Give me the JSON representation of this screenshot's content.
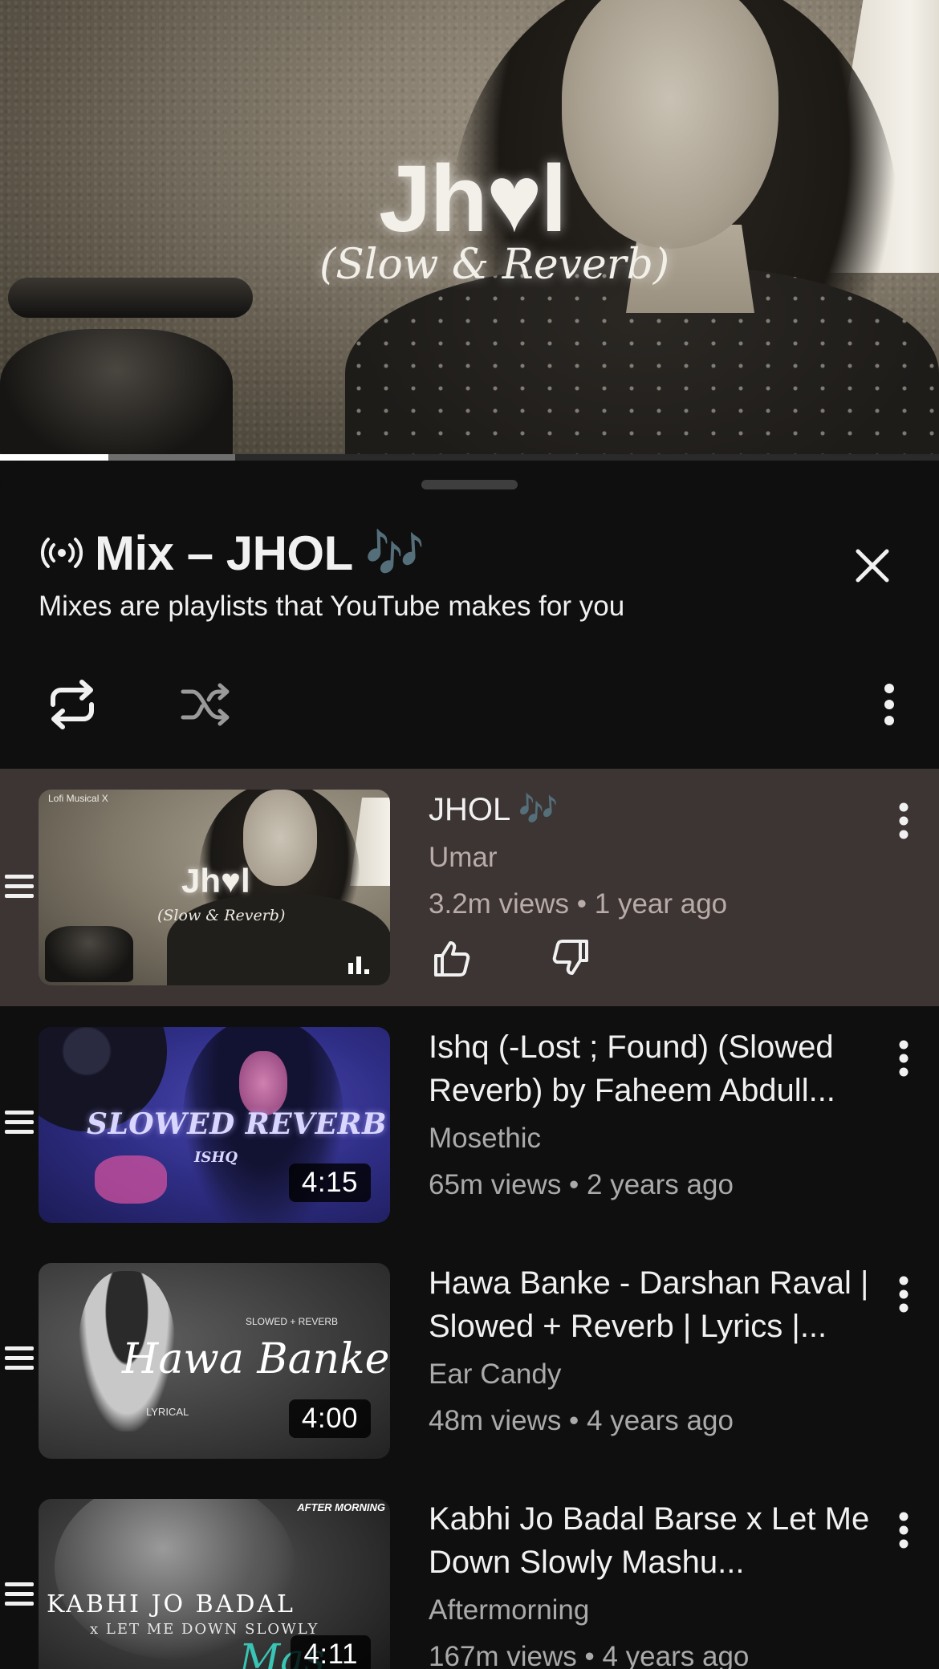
{
  "player": {
    "overlay_title": "Jh♥l",
    "overlay_subtitle": "(Slow & Reverb)",
    "progress": 0.115,
    "buffered": 0.25
  },
  "sheet": {
    "title": "Mix – JHOL 🎶",
    "subtitle": "Mixes are playlists that YouTube makes for you",
    "icons": {
      "mix": "broadcast-icon",
      "close": "close-icon",
      "repeat": "repeat-icon",
      "shuffle": "shuffle-icon",
      "menu": "more-vertical-icon"
    }
  },
  "playlist": [
    {
      "title": "JHOL 🎶",
      "channel": "Umar",
      "meta": "3.2m views • 1 year ago",
      "active": true,
      "thumb": {
        "brand": "Lofi Musical X",
        "text1": "Jh♥l",
        "text2": "(Slow & Reverb)"
      }
    },
    {
      "title": "Ishq (-Lost ; Found) (Slowed Reverb) by Faheem Abdull...",
      "channel": "Mosethic",
      "meta": "65m views • 2 years ago",
      "duration": "4:15",
      "thumb": {
        "text1": "SLOWED REVERB",
        "text2": "ISHQ"
      }
    },
    {
      "title": "Hawa Banke - Darshan Raval | Slowed + Reverb | Lyrics |...",
      "channel": "Ear Candy",
      "meta": "48m views • 4 years ago",
      "duration": "4:00",
      "thumb": {
        "text1": "Hawa Banke",
        "text2": "SLOWED + REVERB",
        "text3": "LYRICAL"
      }
    },
    {
      "title": "Kabhi Jo Badal Barse x Let Me Down Slowly Mashu...",
      "channel": "Aftermorning",
      "meta": "167m views • 4 years ago",
      "duration": "4:11",
      "thumb": {
        "text1": "KABHI JO BADAL",
        "text2": "x  LET ME DOWN SLOWLY",
        "logo": "AFTER MORNING",
        "script": "Mas"
      }
    }
  ],
  "colors": {
    "background": "#0f0f0f",
    "active_row": "#3d3533",
    "secondary_text": "#aaaaaa"
  }
}
